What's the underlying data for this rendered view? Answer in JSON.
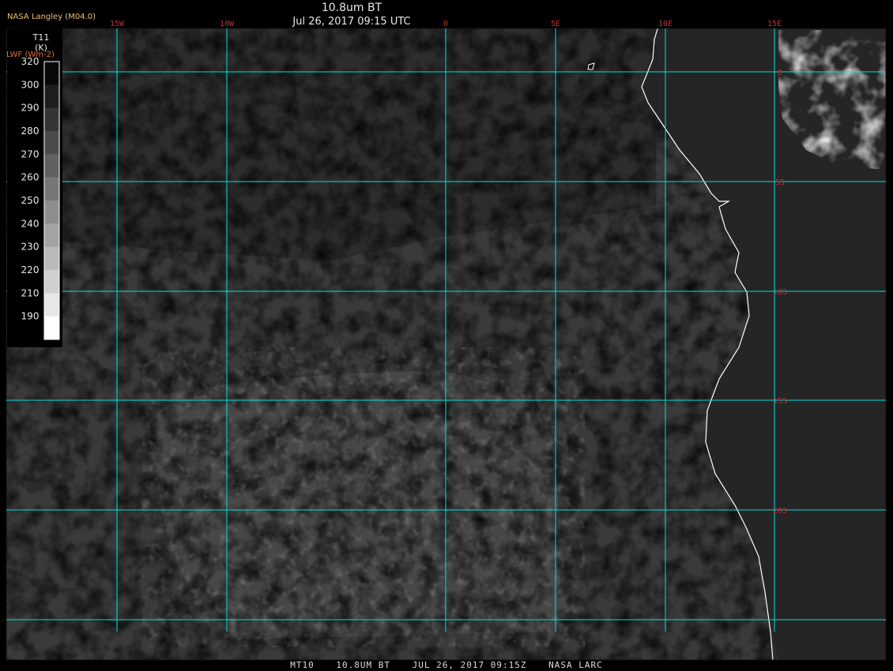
{
  "header": {
    "title": "10.8um BT",
    "datetime": "Jul 26, 2017 09:15 UTC",
    "credit": "NASA Langley (M04.0)"
  },
  "legend": {
    "variable": "T11",
    "unit": "(K)",
    "secondary_label": "LWF (Wm-2)",
    "ticks": [
      "320",
      "300",
      "290",
      "280",
      "270",
      "260",
      "250",
      "240",
      "230",
      "220",
      "210",
      "190"
    ]
  },
  "grid": {
    "longitude_labels": [
      "15W",
      "10W",
      "0",
      "5E",
      "10E",
      "15E"
    ],
    "latitude_labels": [
      "0",
      "5S",
      "10S",
      "15S",
      "20S"
    ],
    "line_color": "#00e0e0",
    "label_color": "#c03030"
  },
  "footer": {
    "satellite": "MT10",
    "channel": "10.8UM BT",
    "timestamp": "JUL 26, 2017 09:15Z",
    "source": "NASA LARC"
  },
  "colors": {
    "ocean": "#3a3a3a",
    "land": "#252525",
    "coastline": "#ffffff",
    "cloud": "#e0e0e0"
  }
}
